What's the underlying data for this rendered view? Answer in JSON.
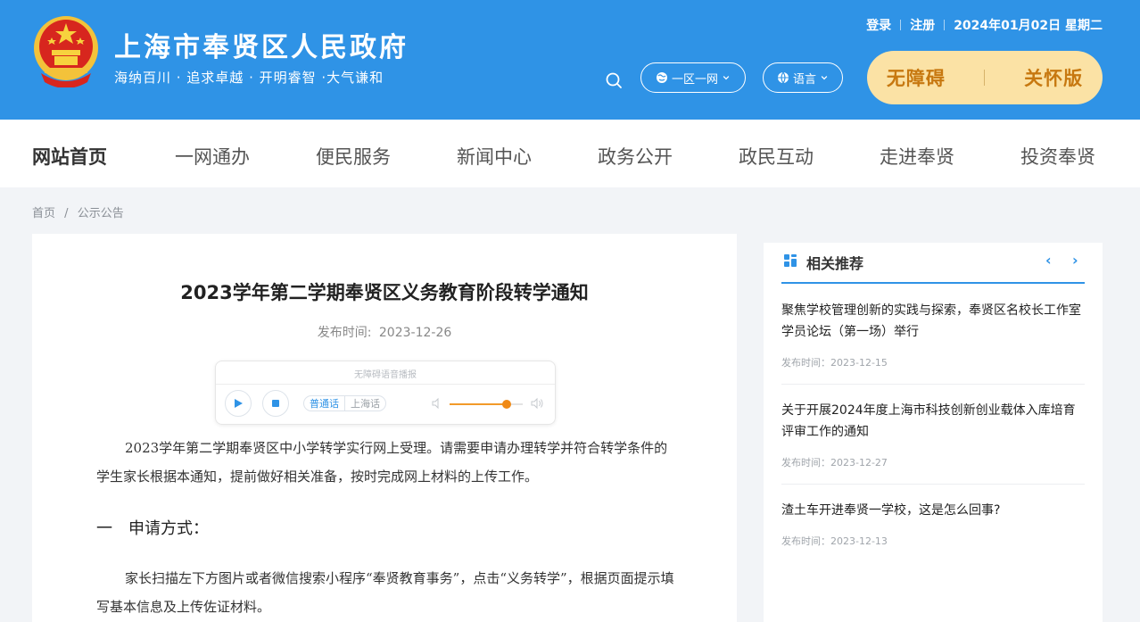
{
  "header": {
    "site_title": "上海市奉贤区人民政府",
    "slogan": "海纳百川 · 追求卓越 · 开明睿智 ·大气谦和",
    "login": "登录",
    "register": "注册",
    "date": "2024年01月02日 星期二",
    "region_select": "一区一网",
    "language_select": "语言",
    "accessible_label": "无障碍",
    "care_label": "关怀版",
    "colors": {
      "brand_blue": "#2f93e6",
      "access_bg": "#fbe2a5",
      "access_text": "#c77810"
    }
  },
  "nav": {
    "items": [
      "网站首页",
      "一网通办",
      "便民服务",
      "新闻中心",
      "政务公开",
      "政民互动",
      "走进奉贤",
      "投资奉贤"
    ],
    "active_index": 0
  },
  "breadcrumb": {
    "home": "首页",
    "current": "公示公告",
    "separator": "/"
  },
  "article": {
    "title": "2023学年第二学期奉贤区义务教育阶段转学通知",
    "publish_label": "发布时间:",
    "publish_date": "2023-12-26",
    "paragraph1": "2023学年第二学期奉贤区中小学转学实行网上受理。请需要申请办理转学并符合转学条件的学生家长根据本通知，提前做好相关准备，按时完成网上材料的上传工作。",
    "section1": "一　申请方式：",
    "paragraph2": "家长扫描左下方图片或者微信搜索小程序“奉贤教育事务”，点击“义务转学”，根据页面提示填写基本信息及上传佐证材料。"
  },
  "player": {
    "title": "无障碍语音播报",
    "dialect_mandarin": "普通话",
    "dialect_shanghai": "上海话",
    "volume_fraction": 0.78
  },
  "sidebar": {
    "title": "相关推荐",
    "prev": "‹",
    "next": "›",
    "items": [
      {
        "title": "聚焦学校管理创新的实践与探索，奉贤区名校长工作室学员论坛（第一场）举行",
        "time": "发布时间：2023-12-15"
      },
      {
        "title": "关于开展2024年度上海市科技创新创业载体入库培育评审工作的通知",
        "time": "发布时间：2023-12-27"
      },
      {
        "title": "渣土车开进奉贤一学校，这是怎么回事?",
        "time": "发布时间：2023-12-13"
      }
    ]
  }
}
